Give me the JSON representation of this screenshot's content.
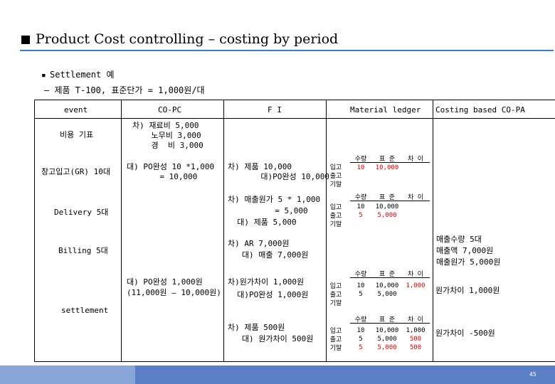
{
  "title": "Product Cost controlling – costing by period",
  "subtitle": {
    "bullet": "▪",
    "line1": "Settlement 예",
    "line2": "– 제품 T-100,  표준단가 = 1,000원/대"
  },
  "headers": {
    "event": "event",
    "copc": "CO-PC",
    "fi": "F I",
    "ml": "Material ledger",
    "cbp": "Costing based CO-PA"
  },
  "rows": {
    "cost": {
      "event": "비용 기표",
      "copc": [
        "차) 재료비 5,000",
        "    노무비 3,000",
        "    경  비 3,000"
      ]
    },
    "gr": {
      "event": "창고입고(GR) 10대",
      "copc": [
        "대) PO완성 10 *1,000",
        "       = 10,000"
      ],
      "fi": [
        "차) 제품 10,000",
        "       대)PO완성 10,000"
      ],
      "ml": {
        "header": [
          "수량",
          "표 준",
          "차 이"
        ],
        "labels": [
          "입고",
          "출고",
          "기말"
        ],
        "rows": [
          [
            "10",
            "10,000",
            ""
          ]
        ]
      }
    },
    "delivery": {
      "event": "Delivery 5대",
      "fi": [
        "차) 매출원가 5 * 1,000",
        "          = 5,000",
        "  대) 제품 5,000"
      ],
      "ml": {
        "header": [
          "수량",
          "표 준",
          "차 이"
        ],
        "labels": [
          "입고",
          "출고",
          "기말"
        ],
        "rows": [
          [
            "10",
            "10,000",
            ""
          ],
          [
            "5",
            "5,000",
            ""
          ]
        ]
      }
    },
    "billing": {
      "event": "Billing 5대",
      "fi": [
        "차) AR 7,000원",
        "   대) 매출 7,000원"
      ],
      "cbp": [
        "매출수량 5대",
        "매출액 7,000원",
        "매출원가 5,000원"
      ]
    },
    "settlement": {
      "event": "settlement",
      "copc": [
        "대) PO완성 1,000원",
        "(11,000원 – 10,000원)"
      ],
      "fi1": [
        "차)원가차이 1,000원",
        "  대)PO완성 1,000원"
      ],
      "ml1": {
        "header": [
          "수량",
          "표 준",
          "차 이"
        ],
        "labels": [
          "입고",
          "출고",
          "기말"
        ],
        "rows": [
          [
            "10",
            "10,000",
            "1,000"
          ],
          [
            "5",
            "5,000",
            ""
          ]
        ]
      },
      "cbp1": "원가차이 1,000원",
      "fi2": [
        "차) 제품 500원",
        "   대) 원가차이 500원"
      ],
      "ml2": {
        "header": [
          "수량",
          "표 준",
          "차 이"
        ],
        "labels": [
          "입고",
          "출고",
          "기말"
        ],
        "rows": [
          [
            "10",
            "10,000",
            "1,000"
          ],
          [
            "5",
            "5,000",
            "500"
          ],
          [
            "5",
            "5,000",
            "500"
          ]
        ]
      },
      "cbp2": "원가차이 -500원"
    }
  },
  "page_number": "45",
  "colors": {
    "accent": "#3a7bd5",
    "red": "#e00000",
    "footer": "#5b7fc6"
  }
}
